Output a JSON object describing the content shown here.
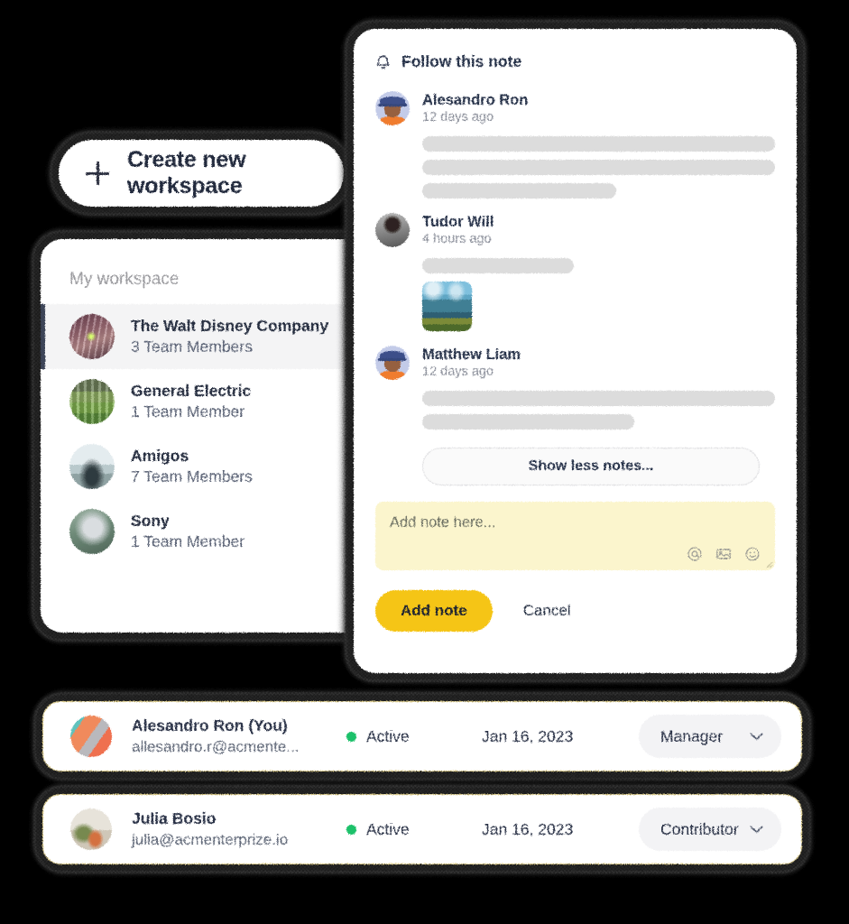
{
  "create_workspace": {
    "label": "Create new workspace",
    "icon": "plus-icon"
  },
  "workspace_panel": {
    "header": "My workspace",
    "items": [
      {
        "name": "The Walt Disney Company",
        "members": "3 Team Members",
        "selected": true,
        "art": "art-tunnel"
      },
      {
        "name": "General Electric",
        "members": "1 Team Member",
        "selected": false,
        "art": "art-garden"
      },
      {
        "name": "Amigos",
        "members": "7 Team Members",
        "selected": false,
        "art": "art-lakegirl"
      },
      {
        "name": "Sony",
        "members": "1 Team Member",
        "selected": false,
        "art": "art-portrait"
      }
    ]
  },
  "notes_panel": {
    "follow": {
      "label": "Follow this note",
      "icon": "bell-icon"
    },
    "notes": [
      {
        "author": "Alesandro Ron",
        "time": "12 days ago",
        "avatar": "toon",
        "lines": [
          100,
          100,
          55
        ],
        "attachment": null
      },
      {
        "author": "Tudor Will",
        "time": "4 hours ago",
        "avatar": "art-manface",
        "lines": [
          43
        ],
        "attachment": "lake-photo"
      },
      {
        "author": "Matthew Liam",
        "time": "12 days ago",
        "avatar": "toon",
        "lines": [
          100,
          60
        ],
        "attachment": null
      }
    ],
    "show_less_label": "Show less notes...",
    "input": {
      "placeholder": "Add note here...",
      "value": "",
      "tools": [
        "mention-icon",
        "image-icon",
        "emoji-icon"
      ]
    },
    "add_note_label": "Add note",
    "cancel_label": "Cancel",
    "accent_color": "#f5c518"
  },
  "members": {
    "status_color": "#1fc16b",
    "rows": [
      {
        "name": "Alesandro Ron (You)",
        "email": "allesandro.r@acmente...",
        "status": "Active",
        "date": "Jan 16, 2023",
        "role": "Manager",
        "art": "art-abstract"
      },
      {
        "name": "Julia Bosio",
        "email": "julia@acmenterprize.io",
        "status": "Active",
        "date": "Jan 16, 2023",
        "role": "Contributor",
        "art": "art-plants"
      }
    ]
  }
}
